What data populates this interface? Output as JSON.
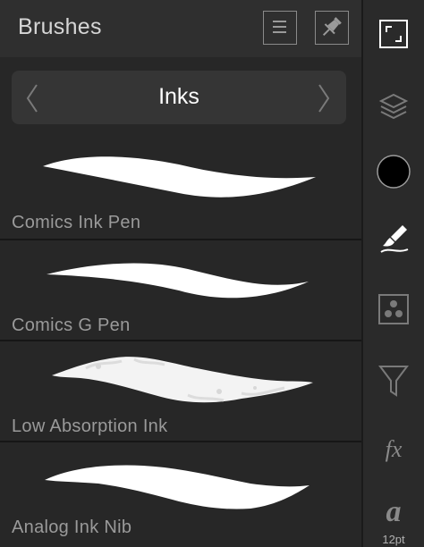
{
  "panel": {
    "title": "Brushes",
    "category": "Inks"
  },
  "brushes": [
    {
      "name": "Comics Ink Pen"
    },
    {
      "name": "Comics G Pen"
    },
    {
      "name": "Low Absorption Ink"
    },
    {
      "name": "Analog Ink Nib"
    }
  ],
  "toolbar": {
    "current_color": "#000000",
    "font_size": "12pt",
    "fx_label": "fx",
    "font_glyph": "a"
  },
  "colors": {
    "panel_bg": "#272727",
    "header_bg": "#2f2f2f",
    "category_bg": "#353535",
    "label_text": "#9a9a9a",
    "active_tool": "#ffffff"
  }
}
